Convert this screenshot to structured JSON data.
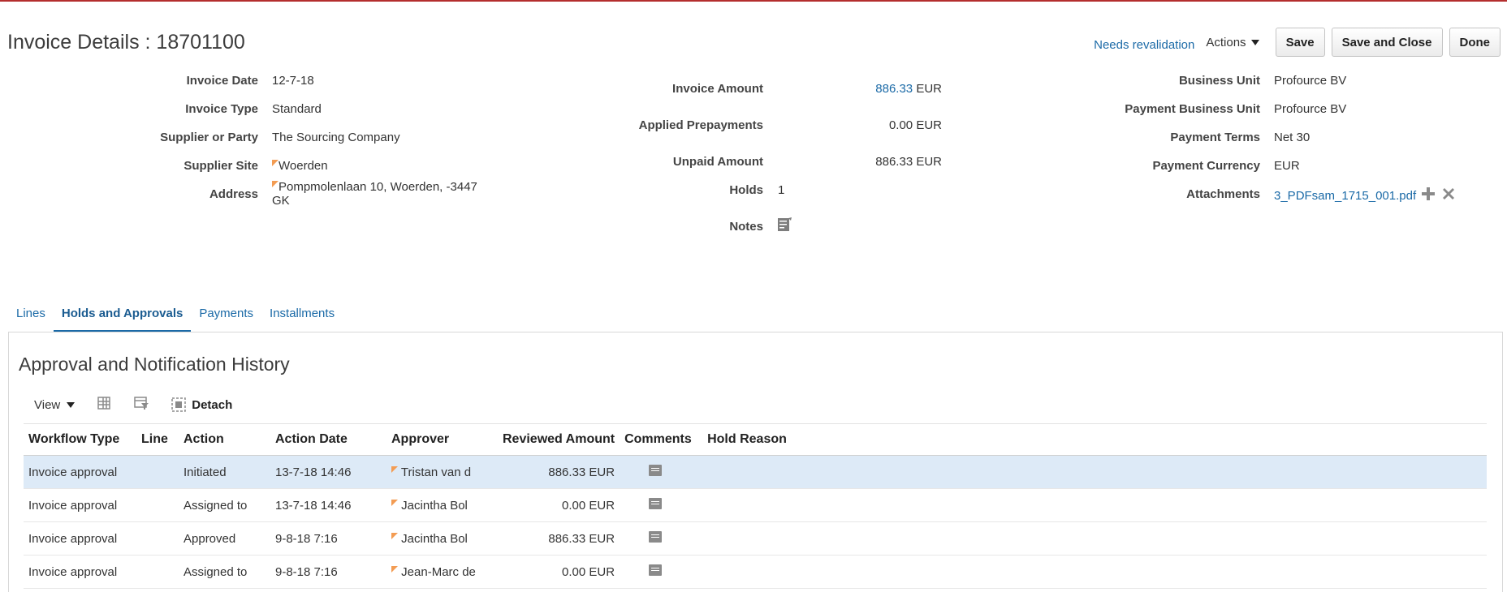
{
  "header": {
    "title": "Invoice Details : 18701100",
    "revalidation_link": "Needs revalidation",
    "actions_label": "Actions",
    "save_label": "Save",
    "save_close_label": "Save and Close",
    "done_label": "Done"
  },
  "left_fields": [
    {
      "label": "Invoice Date",
      "value": "12-7-18"
    },
    {
      "label": "Invoice Type",
      "value": "Standard"
    },
    {
      "label": "Supplier or Party",
      "value": "The Sourcing Company"
    },
    {
      "label": "Supplier Site",
      "value": "Woerden"
    },
    {
      "label": "Address",
      "value": "Pompmolenlaan 10, Woerden, -3447 GK"
    }
  ],
  "middle_fields": {
    "invoice_amount_label": "Invoice Amount",
    "invoice_amount_value": "886.33",
    "invoice_amount_currency": "EUR",
    "applied_prepayments_label": "Applied Prepayments",
    "applied_prepayments_value": "0.00 EUR",
    "unpaid_amount_label": "Unpaid Amount",
    "unpaid_amount_value": "886.33 EUR",
    "holds_label": "Holds",
    "holds_value": "1",
    "notes_label": "Notes"
  },
  "right_fields": [
    {
      "label": "Business Unit",
      "value": "Profource BV"
    },
    {
      "label": "Payment Business Unit",
      "value": "Profource BV"
    },
    {
      "label": "Payment Terms",
      "value": "Net 30"
    },
    {
      "label": "Payment Currency",
      "value": "EUR"
    },
    {
      "label": "Attachments",
      "value": "3_PDFsam_1715_001.pdf"
    }
  ],
  "tabs": [
    {
      "label": "Lines"
    },
    {
      "label": "Holds and Approvals"
    },
    {
      "label": "Payments"
    },
    {
      "label": "Installments"
    }
  ],
  "section": {
    "title": "Approval and Notification History",
    "view_label": "View",
    "detach_label": "Detach"
  },
  "table": {
    "columns": [
      "Workflow Type",
      "Line",
      "Action",
      "Action Date",
      "Approver",
      "Reviewed Amount",
      "Comments",
      "Hold Reason"
    ],
    "rows": [
      {
        "workflow_type": "Invoice approval",
        "line": "",
        "action": "Initiated",
        "action_date": "13-7-18 14:46",
        "approver": "Tristan van d",
        "reviewed_amount": "886.33 EUR",
        "hold_reason": ""
      },
      {
        "workflow_type": "Invoice approval",
        "line": "",
        "action": "Assigned to",
        "action_date": "13-7-18 14:46",
        "approver": "Jacintha Bol",
        "reviewed_amount": "0.00 EUR",
        "hold_reason": ""
      },
      {
        "workflow_type": "Invoice approval",
        "line": "",
        "action": "Approved",
        "action_date": "9-8-18 7:16",
        "approver": "Jacintha Bol",
        "reviewed_amount": "886.33 EUR",
        "hold_reason": ""
      },
      {
        "workflow_type": "Invoice approval",
        "line": "",
        "action": "Assigned to",
        "action_date": "9-8-18 7:16",
        "approver": "Jean-Marc de",
        "reviewed_amount": "0.00 EUR",
        "hold_reason": ""
      }
    ]
  }
}
